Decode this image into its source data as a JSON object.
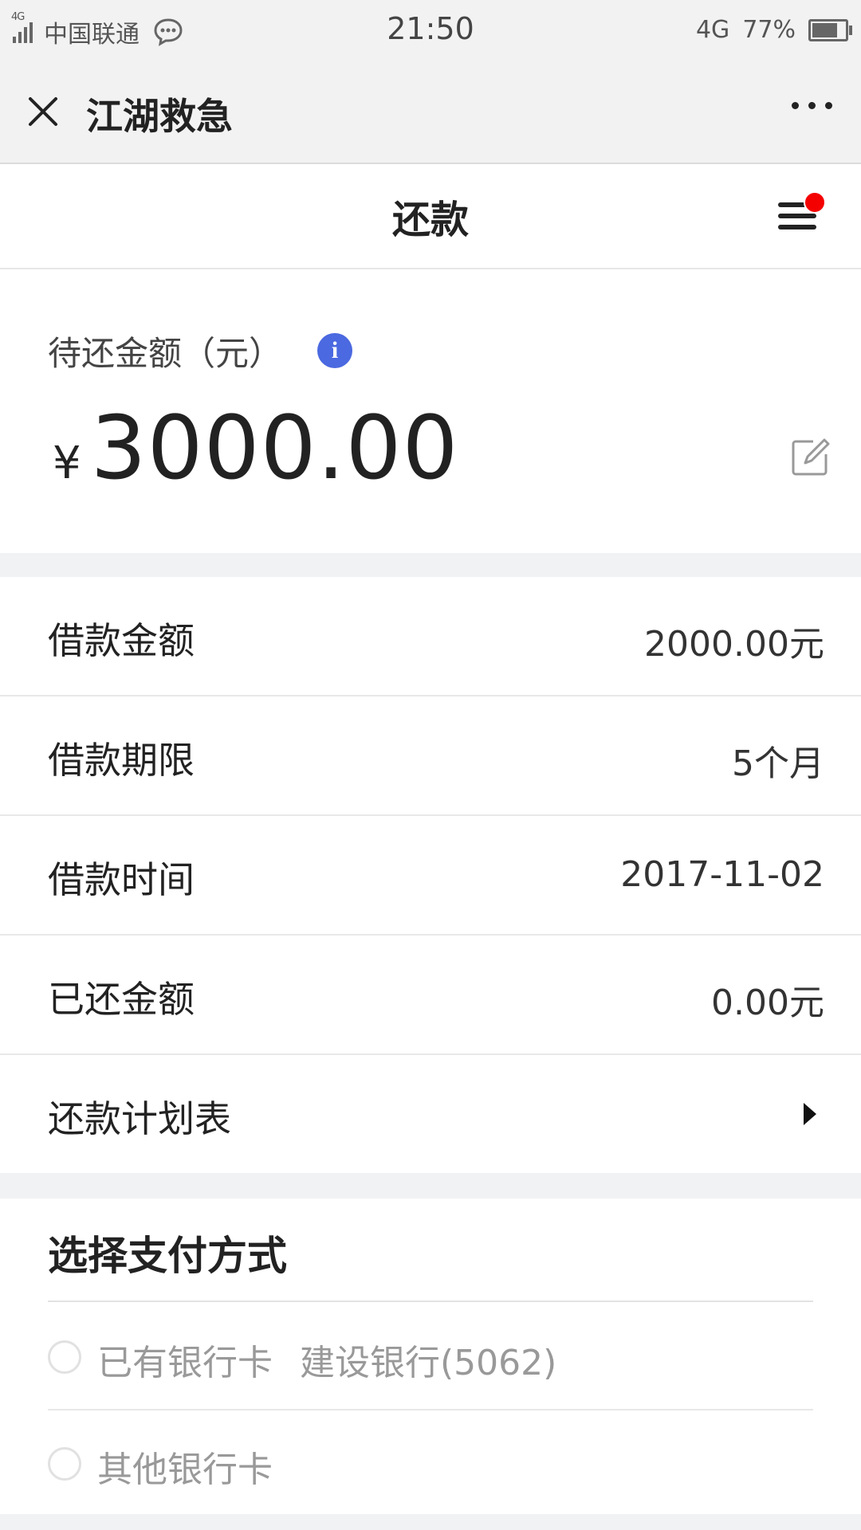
{
  "status_bar": {
    "network_tag": "4G",
    "carrier": "中国联通",
    "time": "21:50",
    "network": "4G",
    "battery": "77%",
    "battery_level": 0.77
  },
  "title_bar": {
    "title": "江湖救急"
  },
  "page_header": {
    "title": "还款"
  },
  "amount_card": {
    "label": "待还金额（元）",
    "currency": "¥",
    "amount": "3000.00"
  },
  "details": [
    {
      "label": "借款金额",
      "value": "2000.00元"
    },
    {
      "label": "借款期限",
      "value": "5个月"
    },
    {
      "label": "借款时间",
      "value": "2017-11-02"
    },
    {
      "label": "已还金额",
      "value": "0.00元"
    },
    {
      "label": "还款计划表",
      "value": ""
    }
  ],
  "payment": {
    "title": "选择支付方式",
    "options": [
      {
        "label": "已有银行卡",
        "bank": "建设银行(5062)"
      },
      {
        "label": "其他银行卡",
        "bank": ""
      }
    ]
  },
  "colors": {
    "accent_blue": "#4b69e0",
    "notification_red": "#f40000"
  },
  "icons": [
    "close-icon",
    "more-icon",
    "menu-icon",
    "info-icon",
    "edit-icon",
    "chevron-right-icon",
    "chat-bubble-icon",
    "signal-icon",
    "battery-icon"
  ]
}
